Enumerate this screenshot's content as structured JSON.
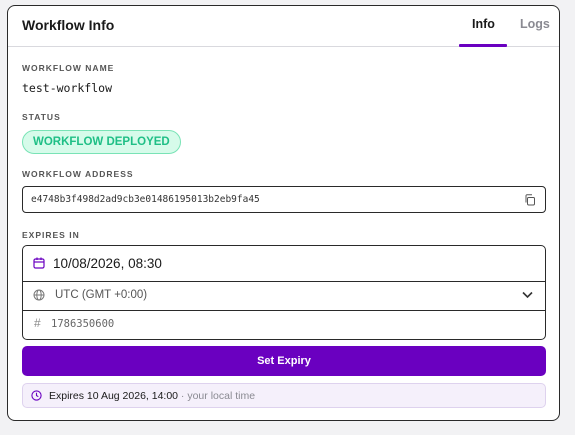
{
  "header": {
    "title": "Workflow Info"
  },
  "tabs": [
    {
      "label": "Info",
      "active": true
    },
    {
      "label": "Logs",
      "active": false
    }
  ],
  "workflow_name": {
    "label": "WORKFLOW NAME",
    "value": "test-workflow"
  },
  "status": {
    "label": "STATUS",
    "badge": "WORKFLOW DEPLOYED"
  },
  "workflow_address": {
    "label": "WORKFLOW ADDRESS",
    "value": "e4748b3f498d2ad9cb3e01486195013b2eb9fa45"
  },
  "expires_in": {
    "label": "EXPIRES IN",
    "datetime": "10/08/2026, 08:30",
    "timezone": "UTC (GMT +0:00)",
    "epoch": "1786350600"
  },
  "set_expiry_button": {
    "label": "Set Expiry"
  },
  "expires_note": {
    "main": "Expires 10 Aug 2026, 14:00",
    "suffix": " · your local time"
  },
  "colors": {
    "accent": "#6a00c0",
    "status_green": "#1fbf86",
    "status_bg": "#d6fbea"
  }
}
